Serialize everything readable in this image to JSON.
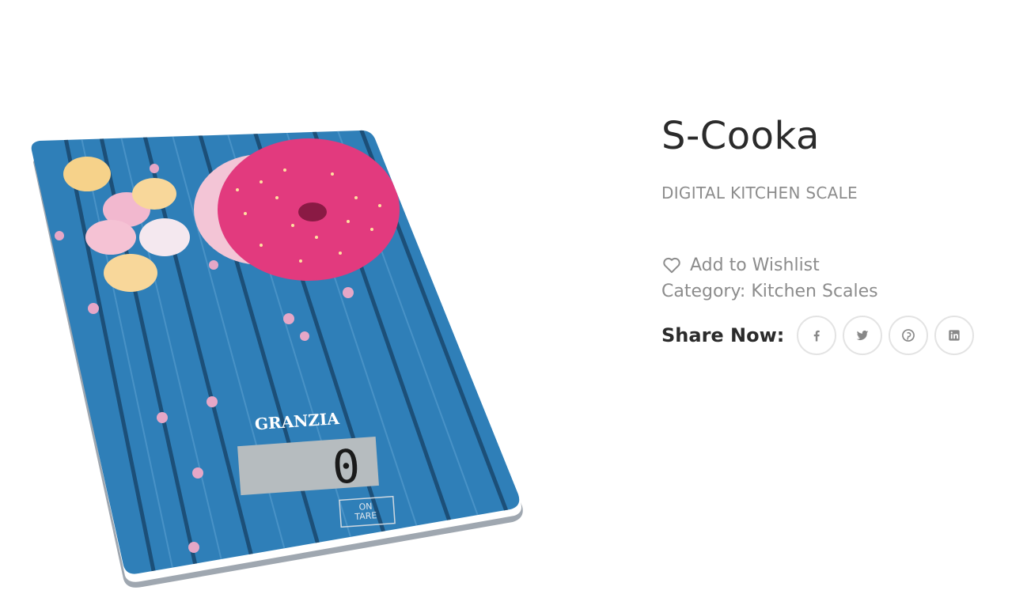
{
  "product": {
    "title": "S-Cooka",
    "subtitle": "DIGITAL KITCHEN SCALE",
    "image": {
      "brand_text": "GRANZIA",
      "display_value": "0",
      "tare_label_1": "ON",
      "tare_label_2": "TARE"
    }
  },
  "actions": {
    "wishlist_label": "Add to Wishlist",
    "wishlist_icon": "heart-outline-icon"
  },
  "category": {
    "prefix": "Category:",
    "value": "Kitchen Scales"
  },
  "share": {
    "label": "Share Now:",
    "networks": [
      "facebook",
      "twitter",
      "pinterest",
      "linkedin"
    ]
  },
  "colors": {
    "title": "#2b2b2b",
    "muted": "#8c8c8c",
    "circle_border": "#e3e3e3",
    "scale_blue": "#2f7fb8",
    "donut_pink": "#e23a7e"
  }
}
